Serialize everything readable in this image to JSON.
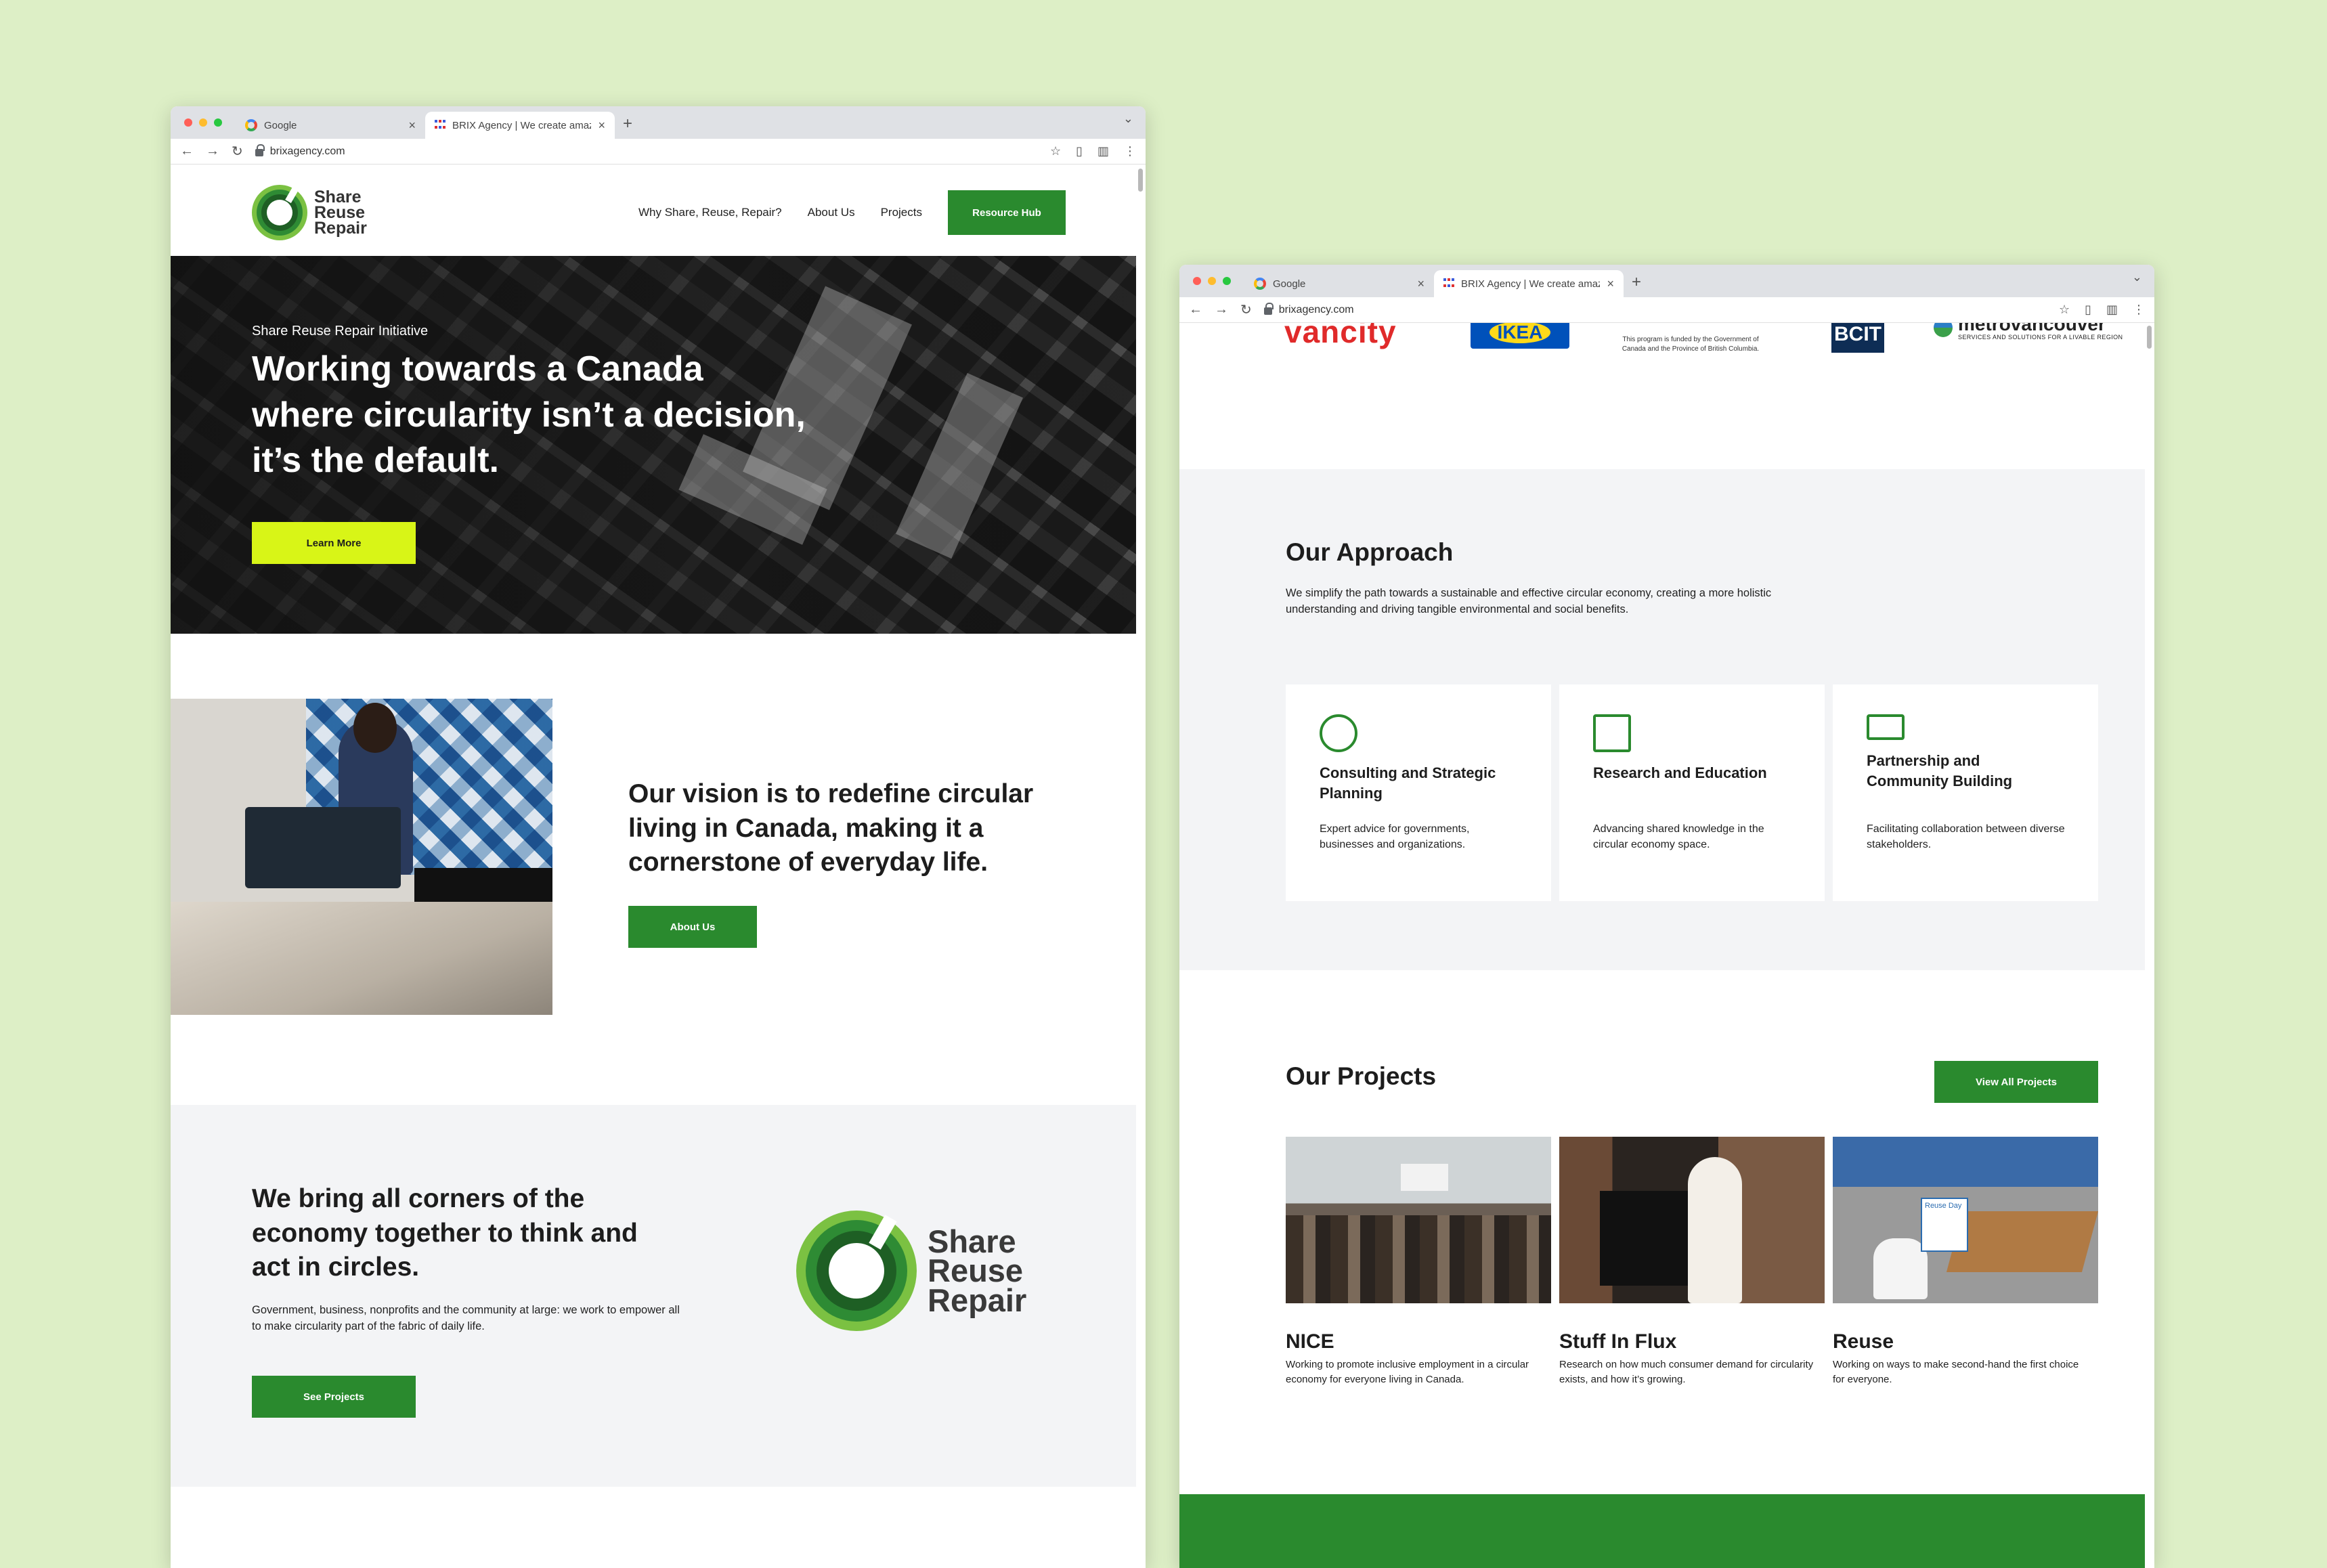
{
  "browser": {
    "tabs": [
      {
        "title": "Google"
      },
      {
        "title": "BRIX Agency | We create amaz"
      }
    ],
    "url": "brixagency.com"
  },
  "site": {
    "logo": {
      "line1": "Share",
      "line2": "Reuse",
      "line3": "Repair"
    },
    "nav": {
      "items": [
        "Why Share, Reuse, Repair?",
        "About Us",
        "Projects"
      ],
      "cta": "Resource Hub"
    },
    "hero": {
      "eyebrow": "Share Reuse Repair Initiative",
      "title": "Working towards a Canada where circularity isn’t a decision, it’s the default.",
      "button": "Learn More"
    },
    "vision": {
      "title": "Our vision is to redefine circular living in Canada, making it a cornerstone of everyday life.",
      "button": "About Us"
    },
    "corners": {
      "title": "We bring all corners of the economy together to think and act in circles.",
      "body": "Government, business, nonprofits and the community at large: we work to empower all to make circularity part of the fabric of daily life.",
      "button": "See Projects"
    },
    "partners": {
      "vancity": "vancity",
      "ikea": "IKEA",
      "govt": "This program is funded by the Government of Canada and the Province of British Columbia.",
      "bcit": "BCIT",
      "metro_name": "metrovancouver",
      "metro_tag": "SERVICES AND SOLUTIONS FOR A LIVABLE REGION"
    },
    "approach": {
      "title": "Our Approach",
      "body": "We simplify the path towards a sustainable and effective circular economy, creating a more holistic understanding and driving tangible environmental and social benefits.",
      "cards": [
        {
          "title": "Consulting and Strategic Planning",
          "body": "Expert advice for governments, businesses and organizations.",
          "icon": "chat-bubbles-icon"
        },
        {
          "title": "Research and Education",
          "body": "Advancing shared knowledge in the circular economy space.",
          "icon": "research-monitor-icon"
        },
        {
          "title": "Partnership and Community Building",
          "body": "Facilitating collaboration between diverse stakeholders.",
          "icon": "community-board-icon"
        }
      ]
    },
    "projects": {
      "title": "Our Projects",
      "button": "View All Projects",
      "items": [
        {
          "name": "NICE",
          "desc": "Working to promote inclusive employment in a circular economy for everyone living in Canada."
        },
        {
          "name": "Stuff In Flux",
          "desc": "Research on how much consumer demand for circularity exists, and how it’s growing."
        },
        {
          "name": "Reuse",
          "desc": "Working on ways to make second-hand the first choice for everyone."
        }
      ],
      "reuse_sign": "Reuse Day"
    }
  },
  "colors": {
    "background": "#ddefc6",
    "brand_green": "#2a8a2e",
    "accent_lime": "#d8f517",
    "section_gray": "#f3f4f6"
  }
}
